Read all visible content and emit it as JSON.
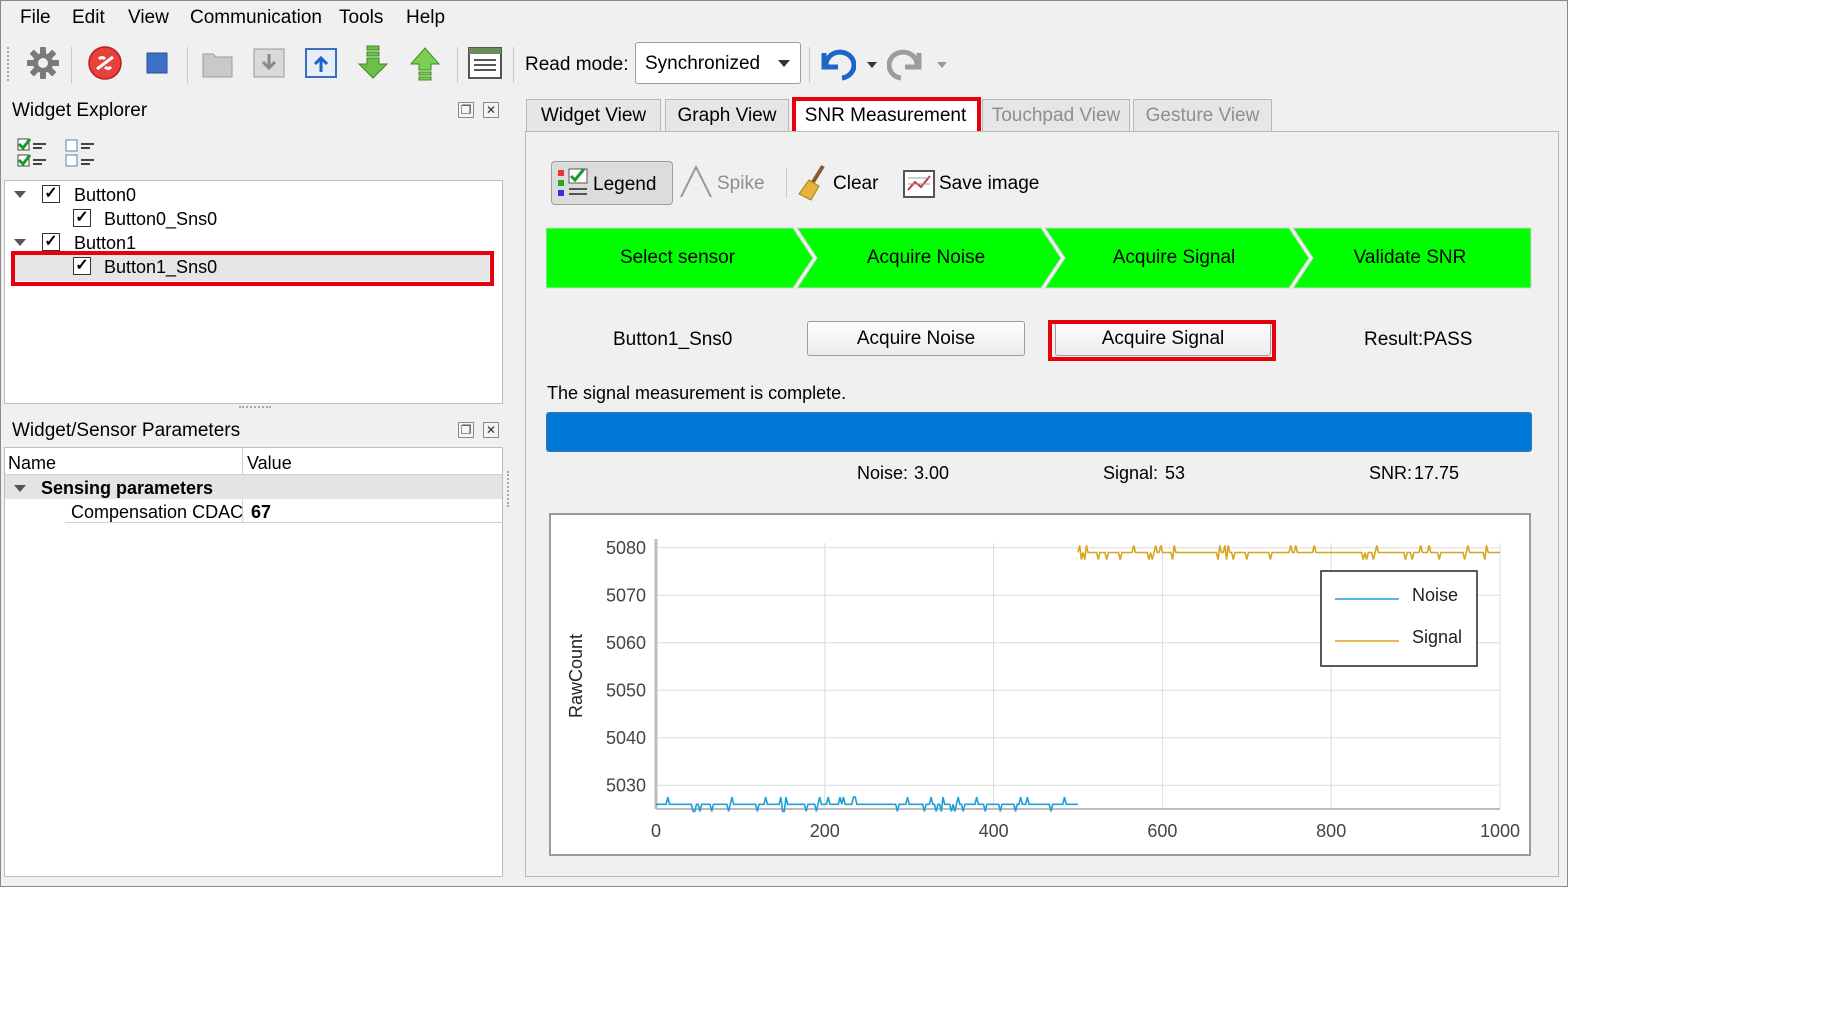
{
  "menubar": {
    "items": [
      "File",
      "Edit",
      "View",
      "Communication",
      "Tools",
      "Help"
    ]
  },
  "toolbar": {
    "read_mode_label": "Read mode:",
    "read_mode_value": "Synchronized"
  },
  "widget_explorer": {
    "title": "Widget Explorer",
    "tree": [
      {
        "label": "Button0",
        "children": [
          {
            "label": "Button0_Sns0"
          }
        ]
      },
      {
        "label": "Button1",
        "children": [
          {
            "label": "Button1_Sns0"
          }
        ]
      }
    ]
  },
  "parameters": {
    "title": "Widget/Sensor Parameters",
    "columns": [
      "Name",
      "Value"
    ],
    "group": "Sensing parameters",
    "rows": [
      {
        "name": "Compensation CDAC",
        "value": "67"
      }
    ]
  },
  "tabs": [
    {
      "label": "Widget View",
      "state": "normal"
    },
    {
      "label": "Graph View",
      "state": "normal"
    },
    {
      "label": "SNR Measurement",
      "state": "active"
    },
    {
      "label": "Touchpad View",
      "state": "disabled"
    },
    {
      "label": "Gesture View",
      "state": "disabled"
    }
  ],
  "snr": {
    "toolbar": {
      "legend": "Legend",
      "spike": "Spike",
      "clear": "Clear",
      "save_image": "Save image"
    },
    "steps": [
      "Select sensor",
      "Acquire Noise",
      "Acquire Signal",
      "Validate SNR"
    ],
    "step_color": "#00ff00",
    "sensor": "Button1_Sns0",
    "acquire_noise": "Acquire Noise",
    "acquire_signal": "Acquire Signal",
    "result": "Result:PASS",
    "status": "The signal measurement is complete.",
    "progress": 1.0,
    "progress_color": "#0078d7",
    "noise_label": "Noise:",
    "noise_value": "3.00",
    "signal_label": "Signal:",
    "signal_value": "53",
    "snr_label": "SNR:",
    "snr_value": "17.75"
  },
  "chart_data": {
    "type": "line",
    "ylabel": "RawCount",
    "xlabel": "",
    "xlim": [
      0,
      1000
    ],
    "ylim": [
      5025,
      5081
    ],
    "xticks": [
      0,
      200,
      400,
      600,
      800,
      1000
    ],
    "yticks": [
      5030,
      5040,
      5050,
      5060,
      5070,
      5080
    ],
    "grid": true,
    "legend_position": "top-right",
    "series": [
      {
        "name": "Noise",
        "color": "#1f9fd8",
        "x_range": [
          0,
          500
        ],
        "level": 5026,
        "jitter": 1.5
      },
      {
        "name": "Signal",
        "color": "#d8a420",
        "x_range": [
          500,
          1000
        ],
        "level": 5079,
        "jitter": 1.5
      }
    ]
  }
}
